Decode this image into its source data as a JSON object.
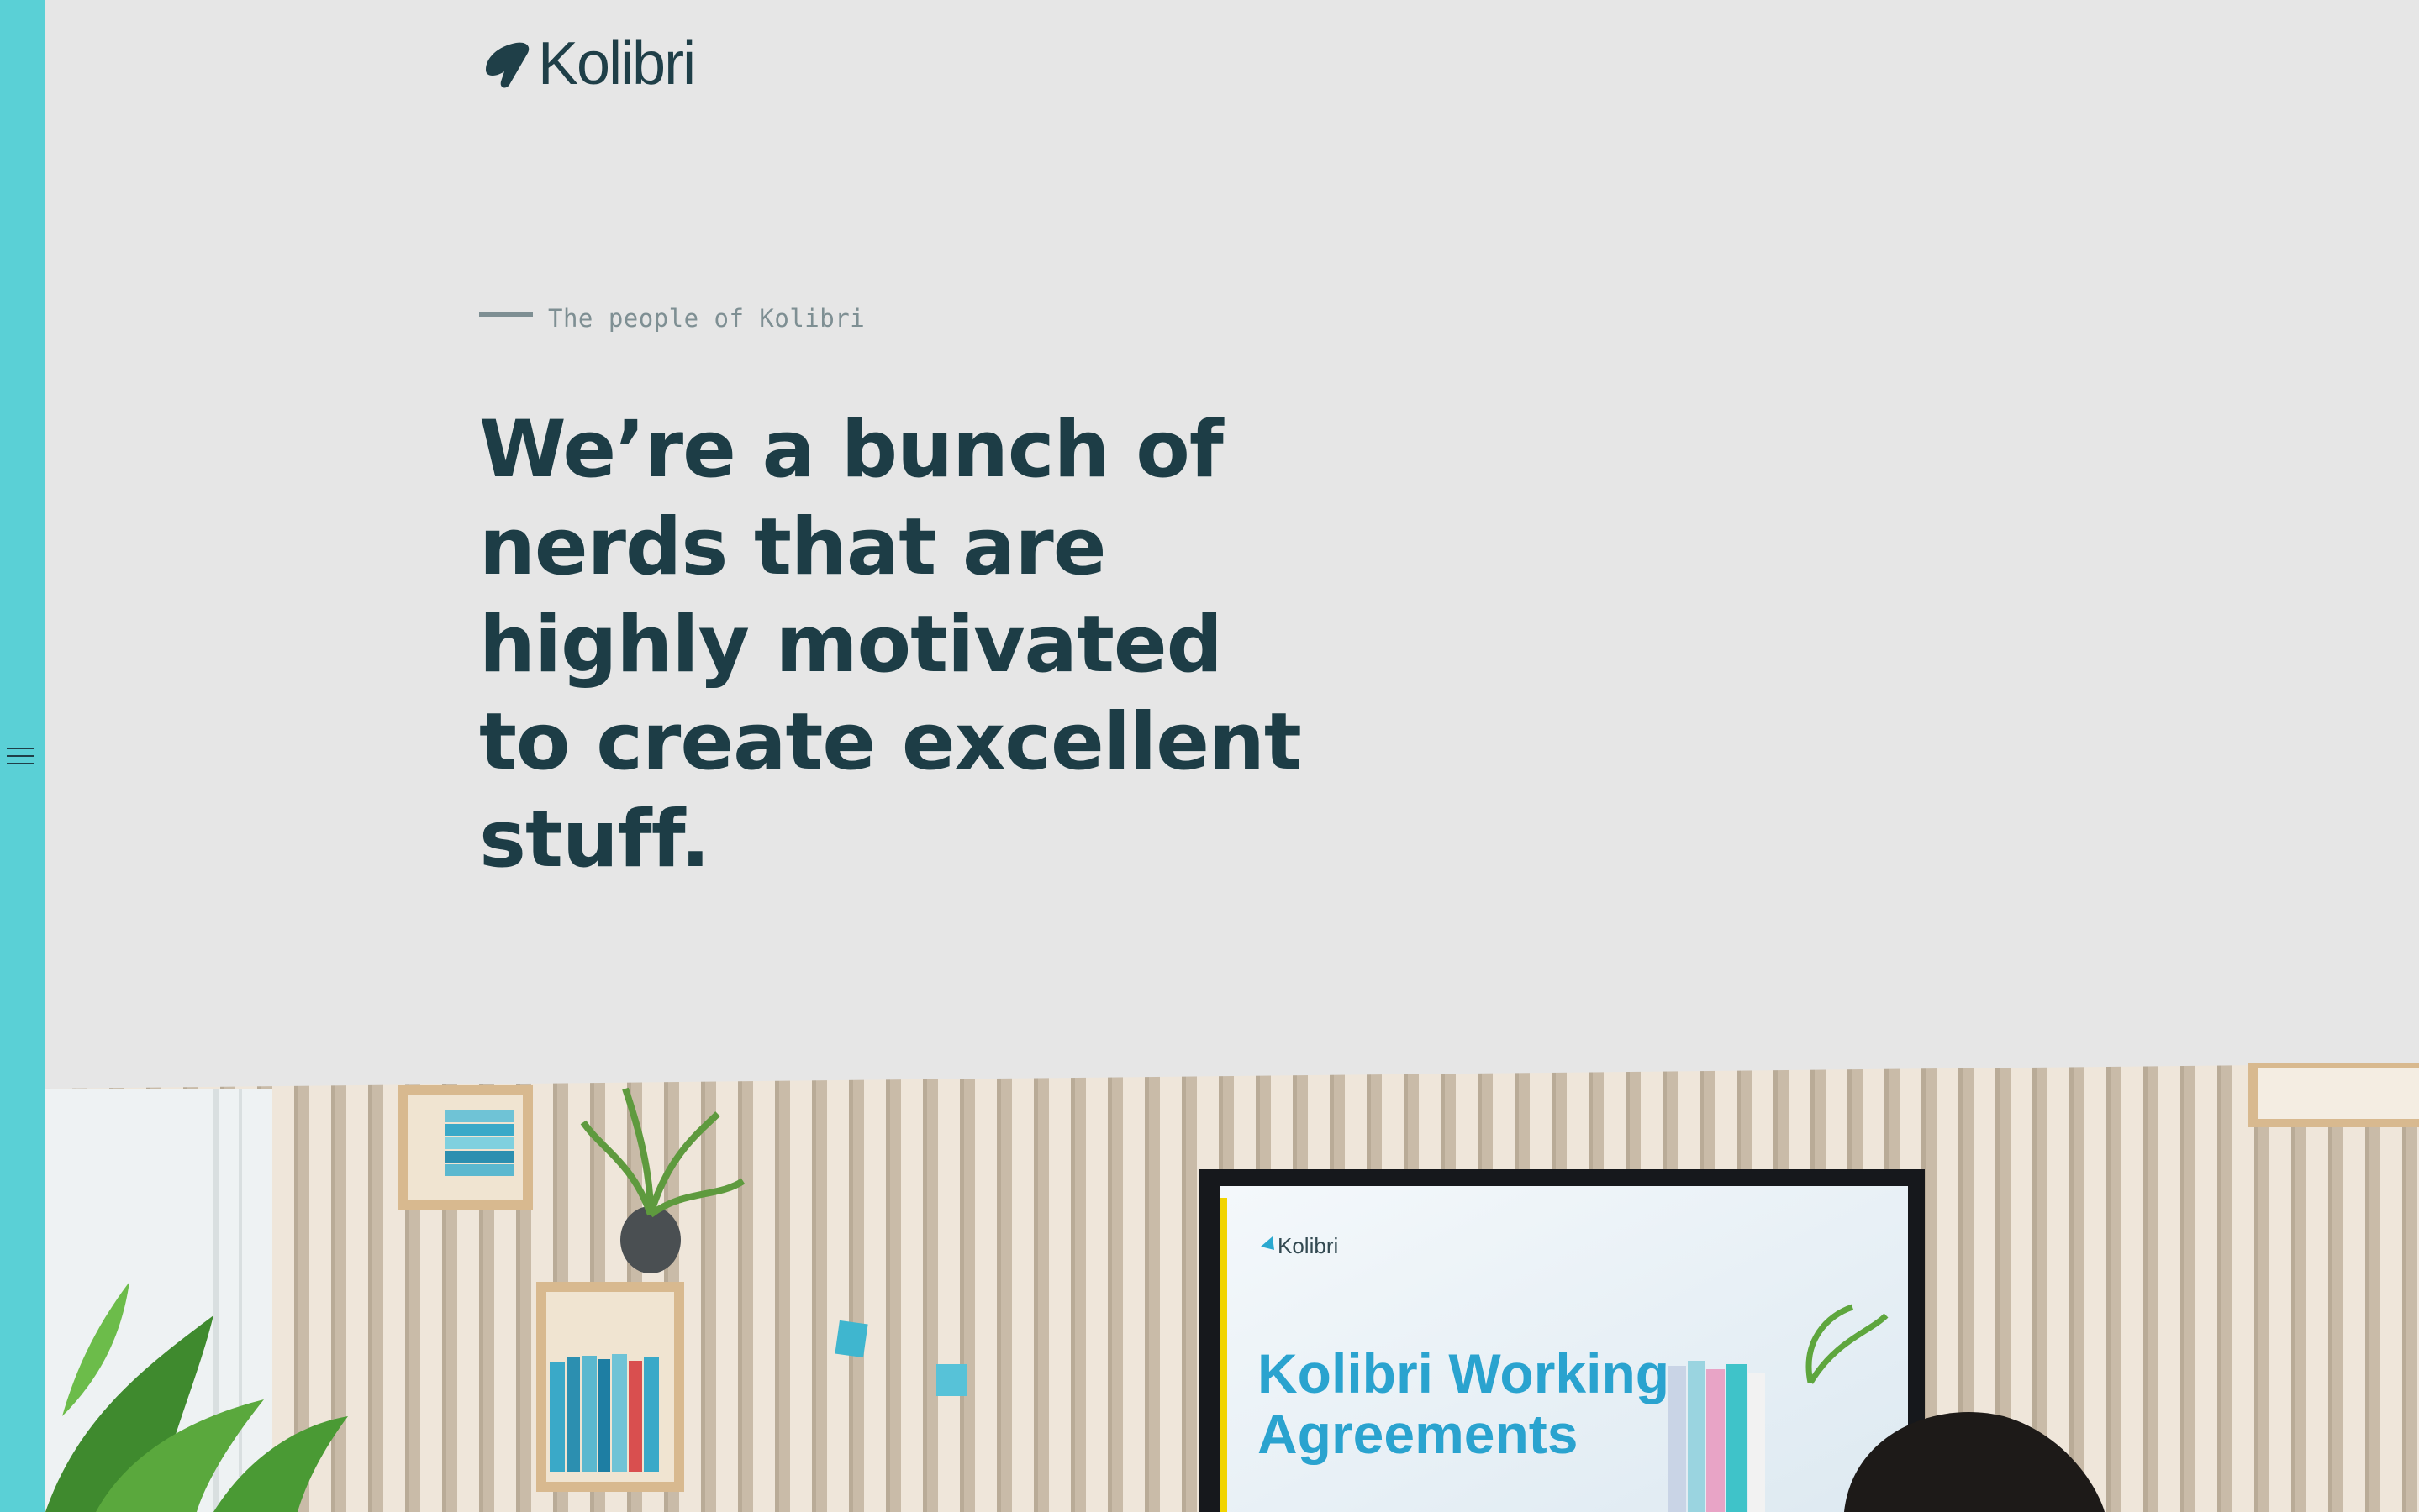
{
  "brand": {
    "name": "Kolibri",
    "colors": {
      "rail": "#5ad0d6",
      "background": "#e6e6e6",
      "heading": "#1d3d46",
      "muted": "#7e8f93"
    }
  },
  "nav": {
    "menu_icon": "hamburger-icon"
  },
  "intro": {
    "eyebrow": "The people of Kolibri",
    "headline": "We’re a bunch of nerds that are highly motivated to create excellent stuff."
  },
  "hero": {
    "screen_logo": "Kolibri",
    "screen_title_line1": "Kolibri Working",
    "screen_title_line2": "Agreements"
  }
}
